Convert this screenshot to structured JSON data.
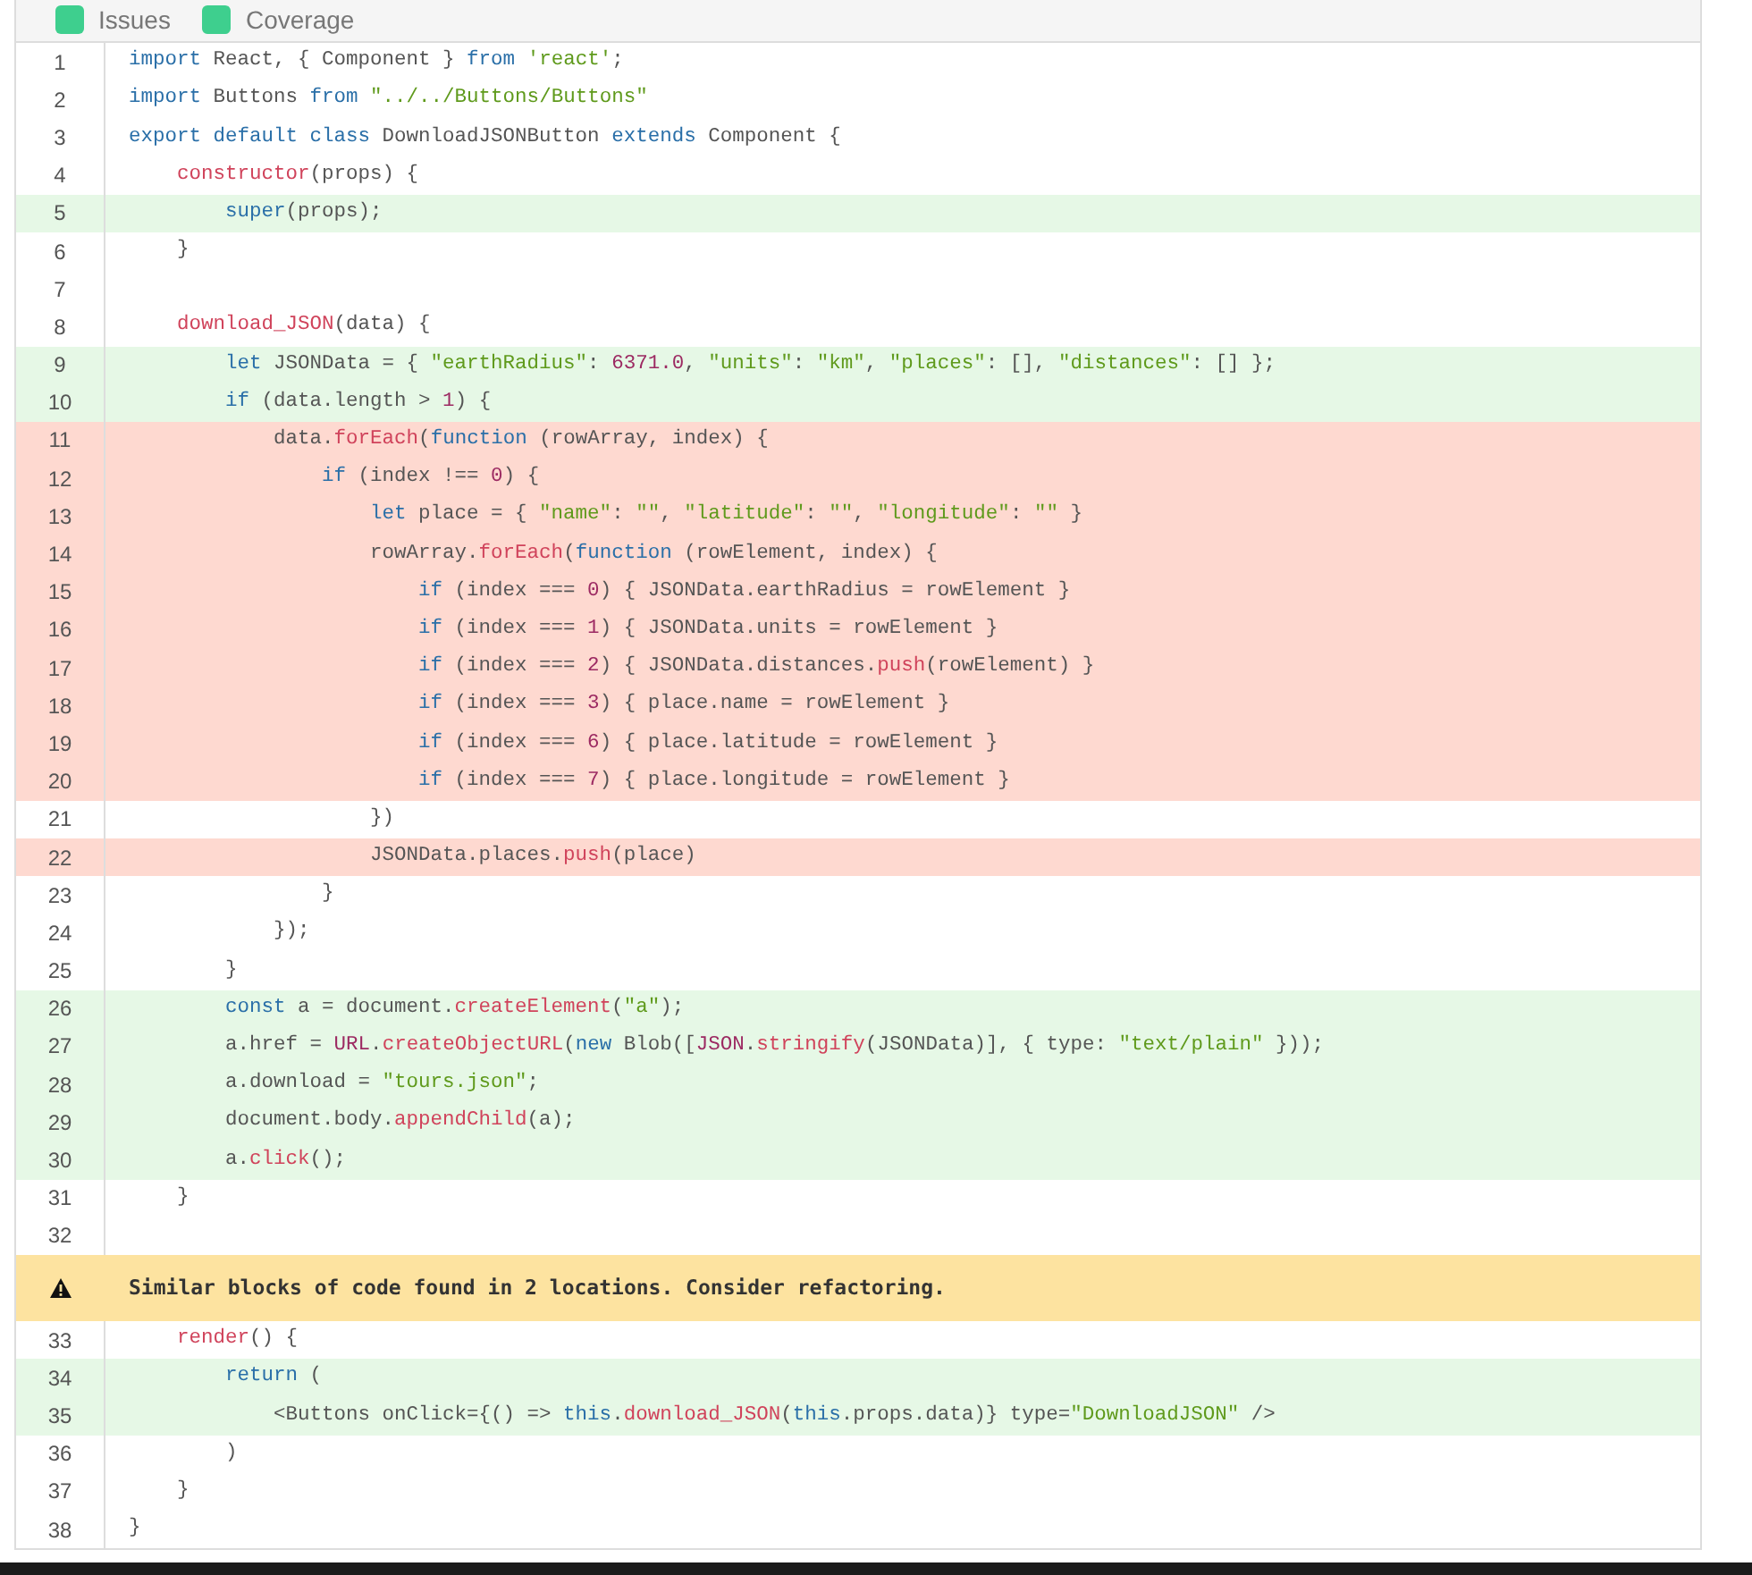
{
  "filters": [
    {
      "label": "Issues",
      "checked": true
    },
    {
      "label": "Coverage",
      "checked": true
    }
  ],
  "lines": [
    {
      "kind": "code",
      "number": "1",
      "covered": false,
      "uncovered": false,
      "segments": [
        {
          "kind": "kw",
          "text": "import"
        },
        {
          "kind": "plain",
          "text": " React, { Component } "
        },
        {
          "kind": "kw",
          "text": "from"
        },
        {
          "kind": "str",
          "text": " 'react'"
        },
        {
          "kind": "plain",
          "text": ";"
        }
      ]
    },
    {
      "kind": "code",
      "number": "2",
      "covered": false,
      "uncovered": false,
      "segments": [
        {
          "kind": "kw",
          "text": "import"
        },
        {
          "kind": "plain",
          "text": " Buttons "
        },
        {
          "kind": "kw",
          "text": "from"
        },
        {
          "kind": "str",
          "text": " \"../../Buttons/Buttons\""
        }
      ]
    },
    {
      "kind": "code",
      "number": "3",
      "covered": false,
      "uncovered": false,
      "segments": [
        {
          "kind": "kw",
          "text": "export default class"
        },
        {
          "kind": "plain",
          "text": " DownloadJSONButton "
        },
        {
          "kind": "kw",
          "text": "extends"
        },
        {
          "kind": "plain",
          "text": " Component {"
        }
      ]
    },
    {
      "kind": "code",
      "number": "4",
      "covered": false,
      "uncovered": false,
      "segments": [
        {
          "kind": "fn",
          "text": "    constructor"
        },
        {
          "kind": "plain",
          "text": "(props) {"
        }
      ]
    },
    {
      "kind": "code",
      "number": "5",
      "covered": true,
      "uncovered": false,
      "segments": [
        {
          "kind": "kw",
          "text": "        super"
        },
        {
          "kind": "plain",
          "text": "(props);"
        }
      ]
    },
    {
      "kind": "code",
      "number": "6",
      "covered": false,
      "uncovered": false,
      "segments": [
        {
          "kind": "plain",
          "text": "    }"
        }
      ]
    },
    {
      "kind": "code",
      "number": "7",
      "covered": false,
      "uncovered": false
    },
    {
      "kind": "code",
      "number": "8",
      "covered": false,
      "uncovered": false,
      "segments": [
        {
          "kind": "fn",
          "text": "    download_JSON"
        },
        {
          "kind": "plain",
          "text": "(data) {"
        }
      ]
    },
    {
      "kind": "code",
      "number": "9",
      "covered": true,
      "uncovered": false,
      "segments": [
        {
          "kind": "kw",
          "text": "        let"
        },
        {
          "kind": "plain",
          "text": " JSONData = { "
        },
        {
          "kind": "str",
          "text": "\"earthRadius\""
        },
        {
          "kind": "plain",
          "text": ": "
        },
        {
          "kind": "num",
          "text": "6371.0"
        },
        {
          "kind": "plain",
          "text": ", "
        },
        {
          "kind": "str",
          "text": "\"units\""
        },
        {
          "kind": "plain",
          "text": ": "
        },
        {
          "kind": "str",
          "text": "\"km\""
        },
        {
          "kind": "plain",
          "text": ", "
        },
        {
          "kind": "str",
          "text": "\"places\""
        },
        {
          "kind": "plain",
          "text": ": [], "
        },
        {
          "kind": "str",
          "text": "\"distances\""
        },
        {
          "kind": "plain",
          "text": ": [] };"
        }
      ]
    },
    {
      "kind": "code",
      "number": "10",
      "covered": true,
      "uncovered": false,
      "segments": [
        {
          "kind": "kw",
          "text": "        if"
        },
        {
          "kind": "plain",
          "text": " (data.length > "
        },
        {
          "kind": "num",
          "text": "1"
        },
        {
          "kind": "plain",
          "text": ") {"
        }
      ]
    },
    {
      "kind": "code",
      "number": "11",
      "covered": false,
      "uncovered": true,
      "segments": [
        {
          "kind": "plain",
          "text": "            data."
        },
        {
          "kind": "fn",
          "text": "forEach"
        },
        {
          "kind": "plain",
          "text": "("
        },
        {
          "kind": "kw",
          "text": "function"
        },
        {
          "kind": "plain",
          "text": " (rowArray, index) {"
        }
      ]
    },
    {
      "kind": "code",
      "number": "12",
      "covered": false,
      "uncovered": true,
      "segments": [
        {
          "kind": "kw",
          "text": "                if"
        },
        {
          "kind": "plain",
          "text": " (index !== "
        },
        {
          "kind": "num",
          "text": "0"
        },
        {
          "kind": "plain",
          "text": ") {"
        }
      ]
    },
    {
      "kind": "code",
      "number": "13",
      "covered": false,
      "uncovered": true,
      "segments": [
        {
          "kind": "kw",
          "text": "                    let"
        },
        {
          "kind": "plain",
          "text": " place = { "
        },
        {
          "kind": "str",
          "text": "\"name\""
        },
        {
          "kind": "plain",
          "text": ": "
        },
        {
          "kind": "str",
          "text": "\"\""
        },
        {
          "kind": "plain",
          "text": ", "
        },
        {
          "kind": "str",
          "text": "\"latitude\""
        },
        {
          "kind": "plain",
          "text": ": "
        },
        {
          "kind": "str",
          "text": "\"\""
        },
        {
          "kind": "plain",
          "text": ", "
        },
        {
          "kind": "str",
          "text": "\"longitude\""
        },
        {
          "kind": "plain",
          "text": ": "
        },
        {
          "kind": "str",
          "text": "\"\""
        },
        {
          "kind": "plain",
          "text": " }"
        }
      ]
    },
    {
      "kind": "code",
      "number": "14",
      "covered": false,
      "uncovered": true,
      "segments": [
        {
          "kind": "plain",
          "text": "                    rowArray."
        },
        {
          "kind": "fn",
          "text": "forEach"
        },
        {
          "kind": "plain",
          "text": "("
        },
        {
          "kind": "kw",
          "text": "function"
        },
        {
          "kind": "plain",
          "text": " (rowElement, index) {"
        }
      ]
    },
    {
      "kind": "code",
      "number": "15",
      "covered": false,
      "uncovered": true,
      "segments": [
        {
          "kind": "kw",
          "text": "                        if"
        },
        {
          "kind": "plain",
          "text": " (index === "
        },
        {
          "kind": "num",
          "text": "0"
        },
        {
          "kind": "plain",
          "text": ") { JSONData.earthRadius = rowElement }"
        }
      ]
    },
    {
      "kind": "code",
      "number": "16",
      "covered": false,
      "uncovered": true,
      "segments": [
        {
          "kind": "kw",
          "text": "                        if"
        },
        {
          "kind": "plain",
          "text": " (index === "
        },
        {
          "kind": "num",
          "text": "1"
        },
        {
          "kind": "plain",
          "text": ") { JSONData.units = rowElement }"
        }
      ]
    },
    {
      "kind": "code",
      "number": "17",
      "covered": false,
      "uncovered": true,
      "segments": [
        {
          "kind": "kw",
          "text": "                        if"
        },
        {
          "kind": "plain",
          "text": " (index === "
        },
        {
          "kind": "num",
          "text": "2"
        },
        {
          "kind": "plain",
          "text": ") { JSONData.distances."
        },
        {
          "kind": "fn",
          "text": "push"
        },
        {
          "kind": "plain",
          "text": "(rowElement) }"
        }
      ]
    },
    {
      "kind": "code",
      "number": "18",
      "covered": false,
      "uncovered": true,
      "segments": [
        {
          "kind": "kw",
          "text": "                        if"
        },
        {
          "kind": "plain",
          "text": " (index === "
        },
        {
          "kind": "num",
          "text": "3"
        },
        {
          "kind": "plain",
          "text": ") { place.name = rowElement }"
        }
      ]
    },
    {
      "kind": "code",
      "number": "19",
      "covered": false,
      "uncovered": true,
      "segments": [
        {
          "kind": "kw",
          "text": "                        if"
        },
        {
          "kind": "plain",
          "text": " (index === "
        },
        {
          "kind": "num",
          "text": "6"
        },
        {
          "kind": "plain",
          "text": ") { place.latitude = rowElement }"
        }
      ]
    },
    {
      "kind": "code",
      "number": "20",
      "covered": false,
      "uncovered": true,
      "segments": [
        {
          "kind": "kw",
          "text": "                        if"
        },
        {
          "kind": "plain",
          "text": " (index === "
        },
        {
          "kind": "num",
          "text": "7"
        },
        {
          "kind": "plain",
          "text": ") { place.longitude = rowElement }"
        }
      ]
    },
    {
      "kind": "code",
      "number": "21",
      "covered": false,
      "uncovered": false,
      "segments": [
        {
          "kind": "plain",
          "text": "                    })"
        }
      ]
    },
    {
      "kind": "code",
      "number": "22",
      "covered": false,
      "uncovered": true,
      "segments": [
        {
          "kind": "plain",
          "text": "                    JSONData.places."
        },
        {
          "kind": "fn",
          "text": "push"
        },
        {
          "kind": "plain",
          "text": "(place)"
        }
      ]
    },
    {
      "kind": "code",
      "number": "23",
      "covered": false,
      "uncovered": false,
      "segments": [
        {
          "kind": "plain",
          "text": "                }"
        }
      ]
    },
    {
      "kind": "code",
      "number": "24",
      "covered": false,
      "uncovered": false,
      "segments": [
        {
          "kind": "plain",
          "text": "            });"
        }
      ]
    },
    {
      "kind": "code",
      "number": "25",
      "covered": false,
      "uncovered": false,
      "segments": [
        {
          "kind": "plain",
          "text": "        }"
        }
      ]
    },
    {
      "kind": "code",
      "number": "26",
      "covered": true,
      "uncovered": false,
      "segments": [
        {
          "kind": "kw",
          "text": "        const"
        },
        {
          "kind": "plain",
          "text": " a = document."
        },
        {
          "kind": "fn",
          "text": "createElement"
        },
        {
          "kind": "plain",
          "text": "("
        },
        {
          "kind": "str",
          "text": "\"a\""
        },
        {
          "kind": "plain",
          "text": ");"
        }
      ]
    },
    {
      "kind": "code",
      "number": "27",
      "covered": true,
      "uncovered": false,
      "segments": [
        {
          "kind": "plain",
          "text": "        a.href = "
        },
        {
          "kind": "num",
          "text": "URL"
        },
        {
          "kind": "plain",
          "text": "."
        },
        {
          "kind": "fn",
          "text": "createObjectURL"
        },
        {
          "kind": "plain",
          "text": "("
        },
        {
          "kind": "kw",
          "text": "new"
        },
        {
          "kind": "plain",
          "text": " Blob(["
        },
        {
          "kind": "num",
          "text": "JSON"
        },
        {
          "kind": "plain",
          "text": "."
        },
        {
          "kind": "fn",
          "text": "stringify"
        },
        {
          "kind": "plain",
          "text": "(JSONData)], { type: "
        },
        {
          "kind": "str",
          "text": "\"text/plain\""
        },
        {
          "kind": "plain",
          "text": " }));"
        }
      ]
    },
    {
      "kind": "code",
      "number": "28",
      "covered": true,
      "uncovered": false,
      "segments": [
        {
          "kind": "plain",
          "text": "        a.download = "
        },
        {
          "kind": "str",
          "text": "\"tours.json\""
        },
        {
          "kind": "plain",
          "text": ";"
        }
      ]
    },
    {
      "kind": "code",
      "number": "29",
      "covered": true,
      "uncovered": false,
      "segments": [
        {
          "kind": "plain",
          "text": "        document.body."
        },
        {
          "kind": "fn",
          "text": "appendChild"
        },
        {
          "kind": "plain",
          "text": "(a);"
        }
      ]
    },
    {
      "kind": "code",
      "number": "30",
      "covered": true,
      "uncovered": false,
      "segments": [
        {
          "kind": "plain",
          "text": "        a."
        },
        {
          "kind": "fn",
          "text": "click"
        },
        {
          "kind": "plain",
          "text": "();"
        }
      ]
    },
    {
      "kind": "code",
      "number": "31",
      "covered": false,
      "uncovered": false,
      "segments": [
        {
          "kind": "plain",
          "text": "    }"
        }
      ]
    },
    {
      "kind": "code",
      "number": "32",
      "covered": false,
      "uncovered": false
    },
    {
      "kind": "issue",
      "message": "Similar blocks of code found in 2 locations. Consider refactoring."
    },
    {
      "kind": "code",
      "number": "33",
      "covered": false,
      "uncovered": false,
      "segments": [
        {
          "kind": "fn",
          "text": "    render"
        },
        {
          "kind": "plain",
          "text": "() {"
        }
      ]
    },
    {
      "kind": "code",
      "number": "34",
      "covered": true,
      "uncovered": false,
      "segments": [
        {
          "kind": "kw",
          "text": "        return"
        },
        {
          "kind": "plain",
          "text": " ("
        }
      ]
    },
    {
      "kind": "code",
      "number": "35",
      "covered": true,
      "uncovered": false,
      "segments": [
        {
          "kind": "plain",
          "text": "            <Buttons onClick={() => "
        },
        {
          "kind": "kw",
          "text": "this"
        },
        {
          "kind": "plain",
          "text": "."
        },
        {
          "kind": "fn",
          "text": "download_JSON"
        },
        {
          "kind": "plain",
          "text": "("
        },
        {
          "kind": "kw",
          "text": "this"
        },
        {
          "kind": "plain",
          "text": ".props.data)} type="
        },
        {
          "kind": "str",
          "text": "\"DownloadJSON\""
        },
        {
          "kind": "plain",
          "text": " />"
        }
      ]
    },
    {
      "kind": "code",
      "number": "36",
      "covered": false,
      "uncovered": false,
      "segments": [
        {
          "kind": "plain",
          "text": "        )"
        }
      ]
    },
    {
      "kind": "code",
      "number": "37",
      "covered": false,
      "uncovered": false,
      "segments": [
        {
          "kind": "plain",
          "text": "    }"
        }
      ]
    },
    {
      "kind": "code",
      "number": "38",
      "covered": false,
      "uncovered": false,
      "segments": [
        {
          "kind": "plain",
          "text": "}"
        }
      ]
    }
  ]
}
